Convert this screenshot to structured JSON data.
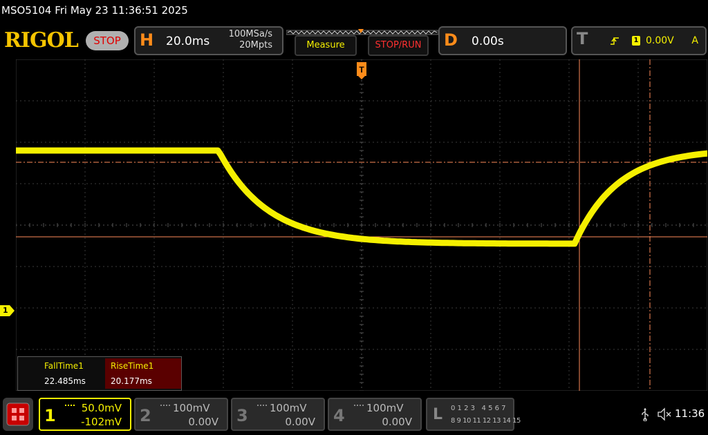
{
  "header": {
    "title": "MSO5104  Fri May 23 11:36:51 2025"
  },
  "topbar": {
    "logo": "RIGOL",
    "run_state": "STOP",
    "horizontal": {
      "letter": "H",
      "timebase": "20.0ms",
      "sample_rate": "100MSa/s",
      "memory_depth": "20Mpts"
    },
    "measure_label": "Measure",
    "stop_run_label": "STOP/RUN",
    "delay": {
      "letter": "D",
      "value": "0.00s"
    },
    "trigger": {
      "letter": "T",
      "source": "1",
      "level": "0.00V",
      "mode": "A"
    }
  },
  "plot": {
    "trigger_marker": "T",
    "channel_marker": "1",
    "colors": {
      "trace": "#f5f000",
      "cursor": "#ff8c5a",
      "grid": "#3c3c3c"
    }
  },
  "measurements": {
    "fall_label": "FallTime1",
    "fall_value": "22.485ms",
    "rise_label": "RiseTime1",
    "rise_value": "20.177ms"
  },
  "channels": [
    {
      "number": "1",
      "scale": "50.0mV",
      "offset": "-102mV",
      "active": true
    },
    {
      "number": "2",
      "scale": "100mV",
      "offset": "0.00V",
      "active": false
    },
    {
      "number": "3",
      "scale": "100mV",
      "offset": "0.00V",
      "active": false
    },
    {
      "number": "4",
      "scale": "100mV",
      "offset": "0.00V",
      "active": false
    }
  ],
  "logic": {
    "letter": "L",
    "row1": "0 1 2 3   4 5 6 7",
    "row2": "8 9 10 11 12 13 14 15"
  },
  "status": {
    "time": "11:36",
    "usb_icon": "usb-icon",
    "sound_icon": "mute-icon"
  }
}
